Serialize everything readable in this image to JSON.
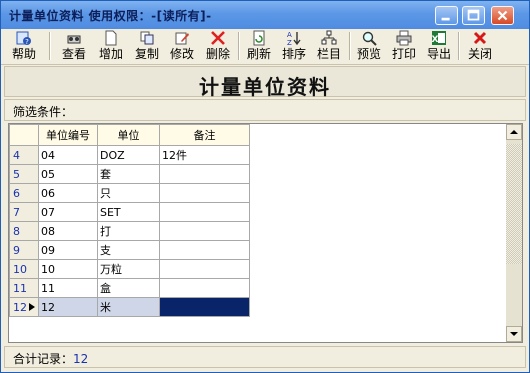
{
  "window": {
    "title": "计量单位资料  使用权限：-[读所有]-"
  },
  "toolbar": {
    "buttons": [
      {
        "label": "帮助",
        "icon": "help-icon"
      },
      {
        "label": "查看",
        "icon": "view-icon"
      },
      {
        "label": "增加",
        "icon": "add-icon"
      },
      {
        "label": "复制",
        "icon": "copy-icon"
      },
      {
        "label": "修改",
        "icon": "edit-icon"
      },
      {
        "label": "删除",
        "icon": "delete-icon"
      },
      {
        "label": "刷新",
        "icon": "refresh-icon"
      },
      {
        "label": "排序",
        "icon": "sort-icon"
      },
      {
        "label": "栏目",
        "icon": "columns-icon"
      },
      {
        "label": "预览",
        "icon": "preview-icon"
      },
      {
        "label": "打印",
        "icon": "print-icon"
      },
      {
        "label": "导出",
        "icon": "export-excel-icon"
      },
      {
        "label": "关闭",
        "icon": "close-icon"
      }
    ]
  },
  "header": {
    "title": "计量单位资料"
  },
  "filter": {
    "label": "筛选条件："
  },
  "grid": {
    "columns": [
      "单位编号",
      "单位",
      "备注"
    ],
    "rows": [
      {
        "num": "4",
        "code": "04",
        "unit": "DOZ",
        "note": "12件"
      },
      {
        "num": "5",
        "code": "05",
        "unit": "套",
        "note": ""
      },
      {
        "num": "6",
        "code": "06",
        "unit": "只",
        "note": ""
      },
      {
        "num": "7",
        "code": "07",
        "unit": "SET",
        "note": ""
      },
      {
        "num": "8",
        "code": "08",
        "unit": "打",
        "note": ""
      },
      {
        "num": "9",
        "code": "09",
        "unit": "支",
        "note": ""
      },
      {
        "num": "10",
        "code": "10",
        "unit": "万粒",
        "note": ""
      },
      {
        "num": "11",
        "code": "11",
        "unit": "盒",
        "note": ""
      },
      {
        "num": "12",
        "code": "12",
        "unit": "米",
        "note": ""
      }
    ],
    "selected_row": "12"
  },
  "status": {
    "label": "合计记录：",
    "count": "12"
  }
}
